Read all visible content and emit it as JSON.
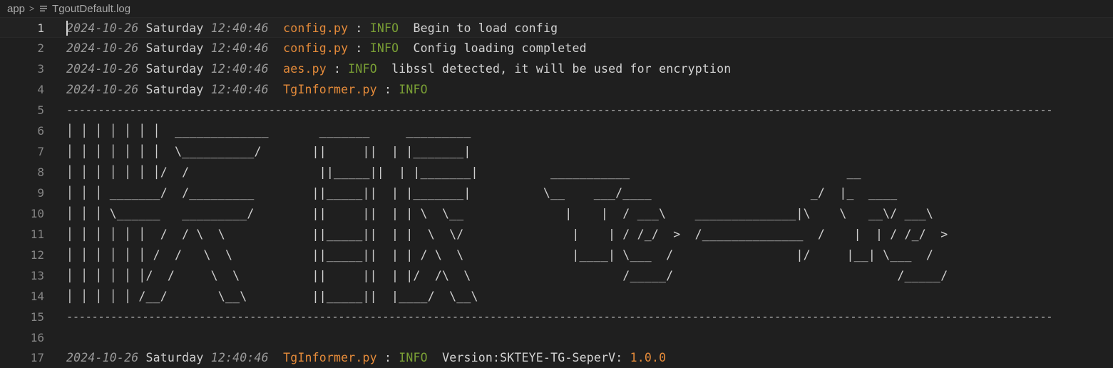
{
  "breadcrumb": {
    "folder": "app",
    "file": "TgoutDefault.log"
  },
  "colors": {
    "background": "#1f1f1f",
    "filename": "#e58b3a",
    "level": "#7a9f35",
    "timestamp": "#9a9a9a",
    "text": "#d4d4d4"
  },
  "lines": [
    {
      "num": "1",
      "date": "2024-10-26",
      "day": "Saturday",
      "time": "12:40:46",
      "file": "config.py",
      "sep": ":",
      "level": "INFO",
      "msg": "Begin to load config"
    },
    {
      "num": "2",
      "date": "2024-10-26",
      "day": "Saturday",
      "time": "12:40:46",
      "file": "config.py",
      "sep": ":",
      "level": "INFO",
      "msg": "Config loading completed"
    },
    {
      "num": "3",
      "date": "2024-10-26",
      "day": "Saturday",
      "time": "12:40:46",
      "file": "aes.py",
      "sep": ":",
      "level": "INFO",
      "msg": "libssl detected, it will be used for encryption"
    },
    {
      "num": "4",
      "date": "2024-10-26",
      "day": "Saturday",
      "time": "12:40:46",
      "file": "TgInformer.py",
      "sep": ":",
      "level": "INFO",
      "msg": ""
    },
    {
      "num": "5",
      "text": "------------------------------------------------------------------------------------------------------------------------------------------------------------"
    },
    {
      "num": "6",
      "text": "│ │ │ │ │ │ │  _____________       _______     _________"
    },
    {
      "num": "7",
      "text": "│ │ │ │ │ │ │  \\__________/       ||     ||  | |_______|"
    },
    {
      "num": "8",
      "text": "│ │ │ │ │ │ │/  /                  ||_____||  | |_______|          ___________                              __"
    },
    {
      "num": "9",
      "text": "│ │ │ _______/  /_________        ||_____||  | |_______|          \\__    ___/____                      _/  |_  ____"
    },
    {
      "num": "10",
      "text": "│ │ │ \\______   _________/        ||     ||  | | \\  \\__              |    |  / ___\\    ______________|\\    \\   __\\/ ___\\"
    },
    {
      "num": "11",
      "text": "│ │ │ │ │ │  /  / \\  \\            ||_____||  | |  \\  \\/               |    | / /_/  >  /______________  /    |  | / /_/  >"
    },
    {
      "num": "12",
      "text": "│ │ │ │ │ │ /  /   \\  \\           ||_____||  | | / \\  \\               |____| \\___  /                 |/     |__| \\___  /"
    },
    {
      "num": "13",
      "text": "│ │ │ │ │ │/  /     \\  \\          ||     ||  | |/  /\\  \\                     /_____/                               /_____/"
    },
    {
      "num": "14",
      "text": "│ │ │ │ │ /__/       \\__\\         ||_____||  |____/  \\__\\"
    },
    {
      "num": "15",
      "text": "------------------------------------------------------------------------------------------------------------------------------------------------------------"
    },
    {
      "num": "16",
      "text": ""
    },
    {
      "num": "17",
      "date": "2024-10-26",
      "day": "Saturday",
      "time": "12:40:46",
      "file": "TgInformer.py",
      "sep": ":",
      "level": "INFO",
      "msg": "Version:SKTEYE-TG-SeperV:",
      "version": "1.0.0"
    }
  ]
}
